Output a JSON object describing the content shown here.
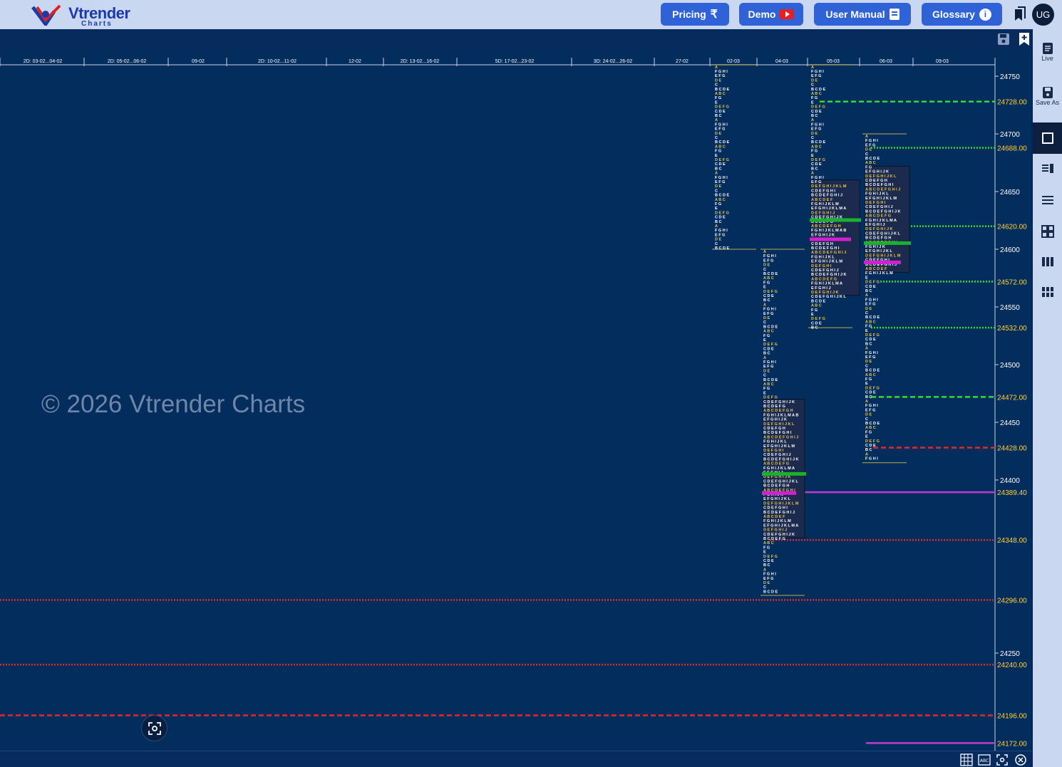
{
  "brand": {
    "name": "Vtrender",
    "sub": "Charts"
  },
  "nav": {
    "pricing": "Pricing",
    "pricing_icon": "rupee-icon",
    "demo": "Demo",
    "demo_icon": "youtube-play-icon",
    "manual": "User Manual",
    "manual_icon": "document-icon",
    "glossary": "Glossary",
    "glossary_icon": "info-icon",
    "avatar": "UG"
  },
  "sidebar": {
    "live": "Live",
    "save_as": "Save As"
  },
  "watermark": "© 2026 Vtrender Charts",
  "colors": {
    "background": "#032d5d",
    "tpo_yellow": "#e8c64a",
    "tpo_white": "#ffffff",
    "value_area_box": "#1c2b4d",
    "poc_green": "#18b22c",
    "vpoc_magenta": "#d21fd2",
    "level_green": "#2be02b",
    "level_red": "#e22828",
    "level_magenta": "#c23ad0",
    "level_label": "#ffd23c"
  },
  "chart_data": {
    "type": "market-profile",
    "x_axis_dates": [
      "2D: 03-02...04-02",
      "2D: 05-02...06-02",
      "09-02",
      "2D: 10-02...11-02",
      "12-02",
      "2D: 13-02...16-02",
      "5D: 17-02...23-02",
      "3D: 24-02...26-02",
      "27-02",
      "02-03",
      "04-03",
      "05-03",
      "06-03",
      "09-03"
    ],
    "y_ticks": [
      24750,
      24700,
      24650,
      24600,
      24550,
      24500,
      24450,
      24400,
      24250
    ],
    "y_range": [
      24165,
      24760
    ],
    "level_labels": [
      {
        "value": "24728.00",
        "color": "green",
        "style": "dashed"
      },
      {
        "value": "24688.00",
        "color": "green",
        "style": "dotted"
      },
      {
        "value": "24620.00",
        "color": "green",
        "style": "dotted"
      },
      {
        "value": "24572.00",
        "color": "green",
        "style": "dotted"
      },
      {
        "value": "24532.00",
        "color": "green",
        "style": "dotted"
      },
      {
        "value": "24472.00",
        "color": "green",
        "style": "dashed"
      },
      {
        "value": "24428.00",
        "color": "red",
        "style": "dashed"
      },
      {
        "value": "24389.40",
        "color": "magenta",
        "style": "solid"
      },
      {
        "value": "24348.00",
        "color": "red",
        "style": "dotted"
      },
      {
        "value": "24296.00",
        "color": "red",
        "style": "dotted"
      },
      {
        "value": "24240.00",
        "color": "red",
        "style": "dotted"
      },
      {
        "value": "24196.00",
        "color": "red",
        "style": "dashed"
      },
      {
        "value": "24172.00",
        "color": "magenta",
        "style": "solid"
      }
    ],
    "profiles": [
      {
        "date": "02-03",
        "high": 24760,
        "low": 24600,
        "poc": null,
        "vah": null,
        "val": null
      },
      {
        "date": "04-03",
        "high": 24600,
        "low": 24300,
        "poc": 24405,
        "vah": 24470,
        "val": 24350
      },
      {
        "date": "05-03",
        "high": 24760,
        "low": 24532,
        "poc": 24625,
        "vah": 24660,
        "val": 24560
      },
      {
        "date": "06-03",
        "high": 24700,
        "low": 24415,
        "poc": 24605,
        "vah": 24672,
        "val": 24580
      }
    ]
  }
}
